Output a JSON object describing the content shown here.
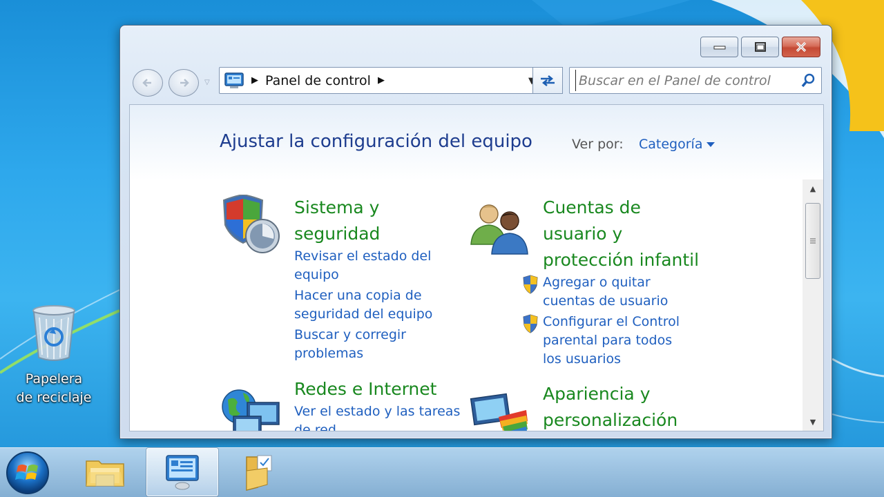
{
  "desktop": {
    "recycle_bin_label": "Papelera de reciclaje"
  },
  "window": {
    "address": {
      "crumb": "Panel de control"
    },
    "search": {
      "placeholder": "Buscar en el Panel de control"
    },
    "content": {
      "title": "Ajustar la configuración del equipo",
      "view_by_label": "Ver por:",
      "view_by_value": "Categoría",
      "categories": [
        {
          "title_lines": [
            "Sistema y",
            "seguridad"
          ],
          "icon": "shield-icon",
          "links": [
            [
              "Revisar el estado del",
              "equipo"
            ],
            [
              "Hacer una copia de",
              "seguridad del equipo"
            ],
            [
              "Buscar y corregir",
              "problemas"
            ]
          ]
        },
        {
          "title_lines": [
            "Cuentas de",
            "usuario y",
            "protección infantil"
          ],
          "icon": "users-icon",
          "links": [
            [
              "Agregar o quitar",
              "cuentas de usuario"
            ],
            [
              "Configurar el Control",
              "parental para todos",
              "los usuarios"
            ]
          ]
        },
        {
          "title_lines": [
            "Redes e Internet"
          ],
          "icon": "network-icon",
          "links": [
            [
              "Ver el estado y las tareas",
              "de red"
            ]
          ]
        },
        {
          "title_lines": [
            "Apariencia y",
            "personalización"
          ],
          "icon": "appearance-icon",
          "links": []
        }
      ]
    }
  },
  "colors": {
    "category_title": "#19881f",
    "link": "#1f5fbf",
    "page_title": "#1e3d8f"
  }
}
